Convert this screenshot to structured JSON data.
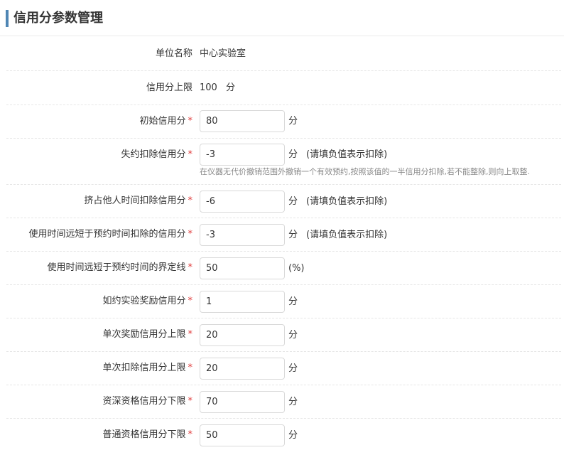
{
  "header": {
    "title": "信用分参数管理"
  },
  "colors": {
    "accent": "#4f86b4",
    "required": "#e03b3b"
  },
  "rows": {
    "unit_name": {
      "label": "单位名称",
      "value": "中心实验室"
    },
    "credit_max": {
      "label": "信用分上限",
      "value": "100",
      "unit": "分"
    },
    "initial": {
      "label": "初始信用分",
      "value": "80",
      "unit": "分"
    },
    "no_show": {
      "label": "失约扣除信用分",
      "value": "-3",
      "unit": "分",
      "hint": "(请填负值表示扣除)",
      "helper": "在仪器无代价撤销范围外撤销一个有效预约,按照该值的一半信用分扣除,若不能整除,则向上取整."
    },
    "occupy": {
      "label": "挤占他人时间扣除信用分",
      "value": "-6",
      "unit": "分",
      "hint": "(请填负值表示扣除)"
    },
    "short_use": {
      "label": "使用时间远短于预约时间扣除的信用分",
      "value": "-3",
      "unit": "分",
      "hint": "(请填负值表示扣除)"
    },
    "short_threshold": {
      "label": "使用时间远短于预约时间的界定线",
      "value": "50",
      "unit": "(%)"
    },
    "on_time_reward": {
      "label": "如约实验奖励信用分",
      "value": "1",
      "unit": "分"
    },
    "reward_max": {
      "label": "单次奖励信用分上限",
      "value": "20",
      "unit": "分"
    },
    "deduct_max": {
      "label": "单次扣除信用分上限",
      "value": "20",
      "unit": "分"
    },
    "senior_min": {
      "label": "资深资格信用分下限",
      "value": "70",
      "unit": "分"
    },
    "normal_min": {
      "label": "普通资格信用分下限",
      "value": "50",
      "unit": "分"
    }
  },
  "required_mark": "*"
}
